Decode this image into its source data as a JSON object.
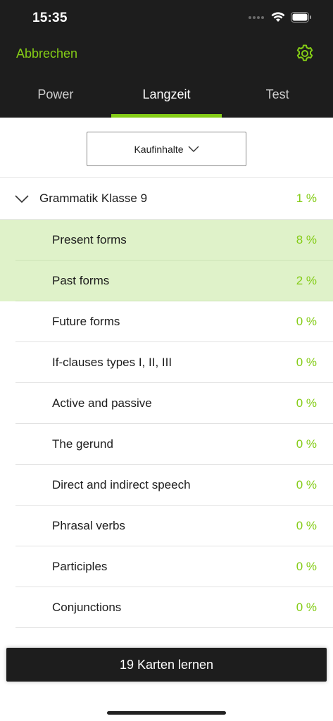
{
  "status_bar": {
    "time": "15:35"
  },
  "header": {
    "cancel_label": "Abbrechen"
  },
  "tabs": [
    {
      "label": "Power"
    },
    {
      "label": "Langzeit"
    },
    {
      "label": "Test"
    }
  ],
  "filter": {
    "label": "Kaufinhalte"
  },
  "group": {
    "label": "Grammatik Klasse 9",
    "percent": "1 %"
  },
  "items": [
    {
      "label": "Present forms",
      "percent": "8 %",
      "highlighted": true
    },
    {
      "label": "Past forms",
      "percent": "2 %",
      "highlighted": true
    },
    {
      "label": "Future forms",
      "percent": "0 %"
    },
    {
      "label": "If-clauses types I, II, III",
      "percent": "0 %"
    },
    {
      "label": "Active and passive",
      "percent": "0 %"
    },
    {
      "label": "The gerund",
      "percent": "0 %"
    },
    {
      "label": "Direct and indirect speech",
      "percent": "0 %"
    },
    {
      "label": "Phrasal verbs",
      "percent": "0 %"
    },
    {
      "label": "Participles",
      "percent": "0 %"
    },
    {
      "label": "Conjunctions",
      "percent": "0 %"
    }
  ],
  "cta": {
    "label": "19 Karten lernen"
  },
  "colors": {
    "accent": "#84cc16",
    "header_bg": "#1d1d1d",
    "highlight_bg": "#dff2c9"
  }
}
